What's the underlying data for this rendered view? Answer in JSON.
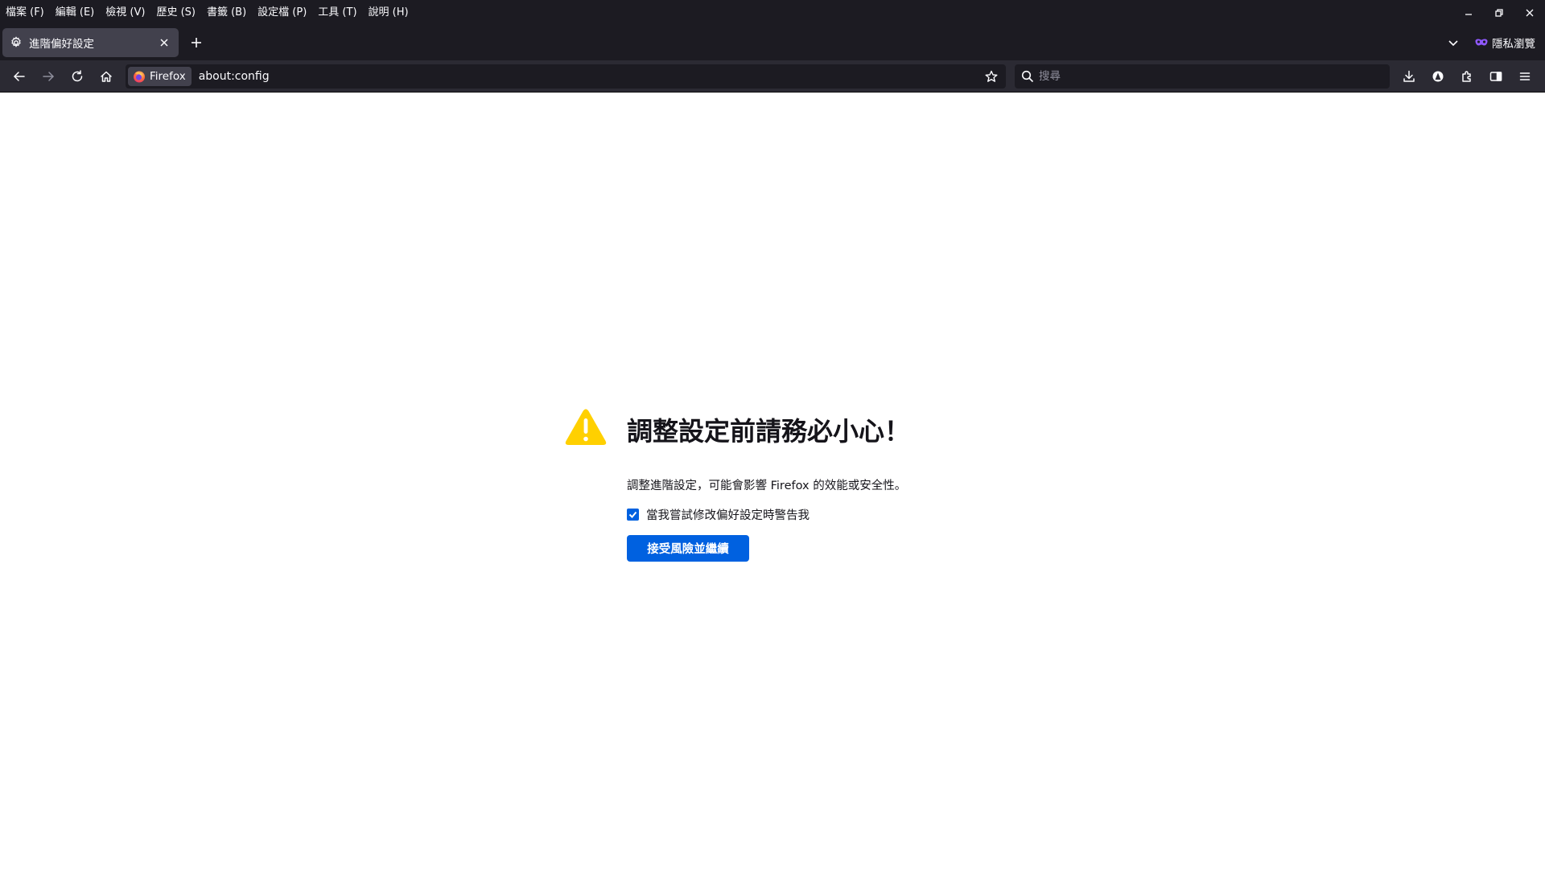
{
  "menubar": {
    "items": [
      {
        "label": "檔案 (F)"
      },
      {
        "label": "編輯 (E)"
      },
      {
        "label": "檢視 (V)"
      },
      {
        "label": "歷史 (S)"
      },
      {
        "label": "書籤 (B)"
      },
      {
        "label": "設定檔 (P)"
      },
      {
        "label": "工具 (T)"
      },
      {
        "label": "說明 (H)"
      }
    ]
  },
  "tabs": {
    "active": {
      "label": "進階偏好設定",
      "icon": "gear-icon"
    },
    "private_label": "隱私瀏覽"
  },
  "navbar": {
    "identity_label": "Firefox",
    "url": "about:config",
    "search_placeholder": "搜尋"
  },
  "warning": {
    "title": "調整設定前請務必小心！",
    "description": "調整進階設定，可能會影響 Firefox 的效能或安全性。",
    "checkbox_label": "當我嘗試修改偏好設定時警告我",
    "checkbox_checked": true,
    "accept_button": "接受風險並繼續"
  },
  "colors": {
    "accent": "#0061e0",
    "warning": "#ffd000",
    "chrome_dark": "#1c1b22",
    "toolbar": "#2b2a33"
  }
}
